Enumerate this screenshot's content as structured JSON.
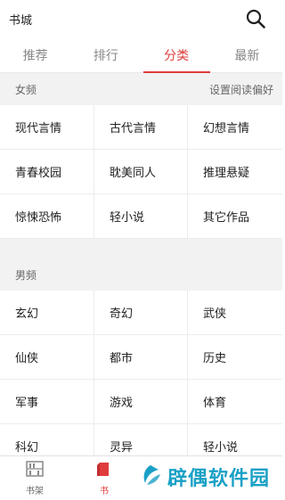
{
  "header": {
    "title": "书城",
    "icon": "search-icon"
  },
  "tabs": [
    {
      "label": "推荐",
      "active": false
    },
    {
      "label": "排行",
      "active": false
    },
    {
      "label": "分类",
      "active": true
    },
    {
      "label": "最新",
      "active": false
    }
  ],
  "female": {
    "label": "女频",
    "settings_link": "设置阅读偏好",
    "categories": [
      "现代言情",
      "古代言情",
      "幻想言情",
      "青春校园",
      "耽美同人",
      "推理悬疑",
      "惊悚恐怖",
      "轻小说",
      "其它作品"
    ]
  },
  "male": {
    "label": "男频",
    "categories": [
      "玄幻",
      "奇幻",
      "武侠",
      "仙侠",
      "都市",
      "历史",
      "军事",
      "游戏",
      "体育",
      "科幻",
      "灵异",
      "轻小说"
    ]
  },
  "bottom_nav": [
    {
      "label": "书架",
      "icon": "bookshelf-icon",
      "active": false
    },
    {
      "label": "书",
      "icon": "store-icon",
      "active": true
    }
  ],
  "watermark": {
    "text": "辟偶软件园"
  },
  "colors": {
    "accent": "#e03c3c",
    "section_bg": "#f2f2f2",
    "watermark": "#1aa0c6"
  }
}
